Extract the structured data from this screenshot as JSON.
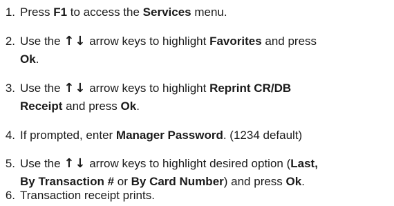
{
  "steps": [
    {
      "number": "1.",
      "lines": [
        [
          {
            "t": "Press "
          },
          {
            "t": "F1",
            "b": true
          },
          {
            "t": " to access the "
          },
          {
            "t": "Services",
            "b": true
          },
          {
            "t": " menu."
          }
        ]
      ]
    },
    {
      "number": "2.",
      "lines": [
        [
          {
            "t": "Use the "
          },
          {
            "t": "↑↓",
            "arrows": true
          },
          {
            "t": " arrow keys to highlight "
          },
          {
            "t": "Favorites",
            "b": true
          },
          {
            "t": " and press"
          }
        ],
        [
          {
            "t": "Ok",
            "b": true
          },
          {
            "t": "."
          }
        ]
      ]
    },
    {
      "number": "3.",
      "lines": [
        [
          {
            "t": "Use the "
          },
          {
            "t": "↑↓",
            "arrows": true
          },
          {
            "t": " arrow keys to highlight "
          },
          {
            "t": "Reprint CR/DB",
            "b": true
          }
        ],
        [
          {
            "t": "Receipt",
            "b": true
          },
          {
            "t": " and press "
          },
          {
            "t": "Ok",
            "b": true
          },
          {
            "t": "."
          }
        ]
      ]
    },
    {
      "number": "4.",
      "lines": [
        [
          {
            "t": "If prompted, enter "
          },
          {
            "t": "Manager Password",
            "b": true
          },
          {
            "t": ". (1234 default)"
          }
        ]
      ]
    },
    {
      "number": "5.",
      "lines": [
        [
          {
            "t": "Use the "
          },
          {
            "t": "↑↓",
            "arrows": true
          },
          {
            "t": " arrow keys to highlight desired option ("
          },
          {
            "t": "Last,",
            "b": true
          }
        ],
        [
          {
            "t": "By Transaction #",
            "b": true
          },
          {
            "t": " or "
          },
          {
            "t": "By Card Number",
            "b": true
          },
          {
            "t": ") and press "
          },
          {
            "t": "Ok",
            "b": true
          },
          {
            "t": "."
          }
        ]
      ]
    },
    {
      "number": "6.",
      "lines": [
        [
          {
            "t": "Transaction receipt prints."
          }
        ]
      ]
    }
  ]
}
